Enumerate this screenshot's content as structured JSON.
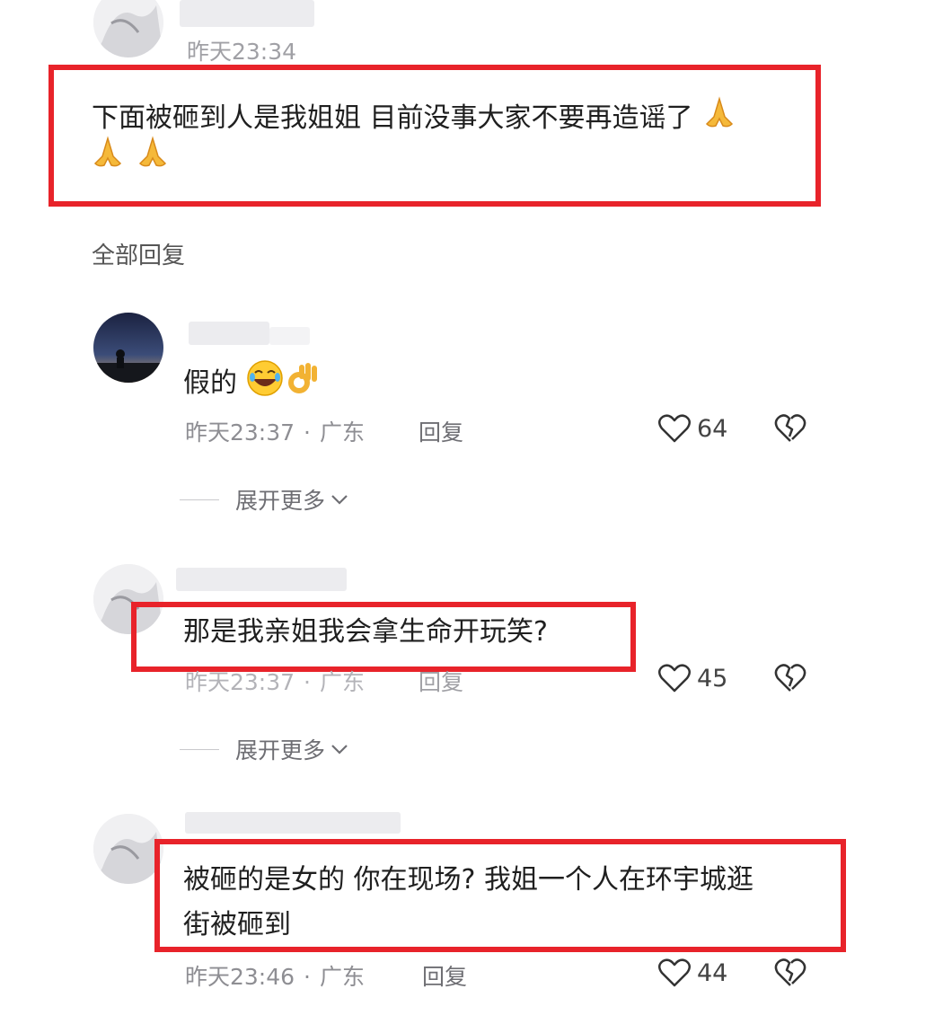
{
  "top_comment": {
    "time": "昨天23:34",
    "text_line1": "下面被砸到人是我姐姐 目前没事大家不要再造谣了",
    "emoji_count": 3
  },
  "all_replies_label": "全部回复",
  "replies": [
    {
      "text": "假的",
      "time": "昨天23:37",
      "separator": "·",
      "location": "广东",
      "reply_label": "回复",
      "likes": "64",
      "expand_label": "展开更多"
    },
    {
      "text": "那是我亲姐我会拿生命开玩笑?",
      "time": "昨天23:37",
      "separator": "·",
      "location": "广东",
      "reply_label": "回复",
      "likes": "45",
      "expand_label": "展开更多"
    },
    {
      "text_line1": "被砸的是女的 你在现场? 我姐一个人在环宇城逛",
      "text_line2": "街被砸到",
      "time": "昨天23:46",
      "separator": "·",
      "location": "广东",
      "reply_label": "回复",
      "likes": "44"
    }
  ],
  "colors": {
    "highlight_box": "#e8232a",
    "meta_text": "#8e8e93"
  },
  "icons": [
    "heart-icon",
    "broken-heart-icon",
    "chevron-down-icon",
    "folded-hands-emoji",
    "laughing-emoji",
    "ok-hand-emoji"
  ]
}
